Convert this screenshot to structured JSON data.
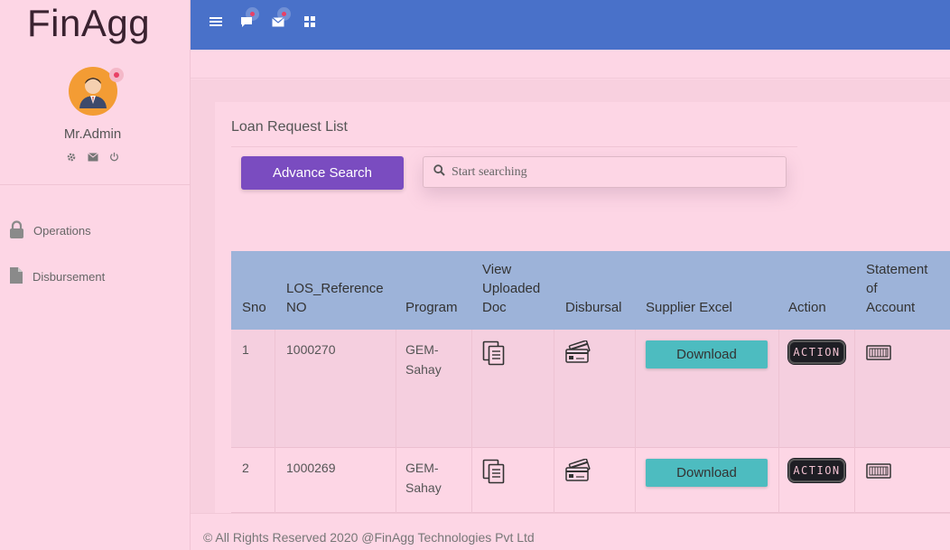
{
  "sidebar": {
    "brand": "FinAgg",
    "user_name": "Mr.Admin",
    "nav": [
      {
        "label": "Operations",
        "icon": "lock-icon"
      },
      {
        "label": "Disbursement",
        "icon": "file-icon"
      }
    ]
  },
  "topbar": {
    "icons": [
      "menu-icon",
      "chat-icon",
      "mail-icon",
      "grid-icon"
    ],
    "color": "#4971c9"
  },
  "card": {
    "title": "Loan Request List",
    "advance_search_label": "Advance Search",
    "search_placeholder": "Start searching"
  },
  "table": {
    "headers": {
      "sno": "Sno",
      "los_1": "LOS_Reference",
      "los_2": "NO",
      "program": "Program",
      "view_1": "View",
      "view_2": "Uploaded",
      "view_3": "Doc",
      "disbursal": "Disbursal",
      "supplier": "Supplier Excel",
      "action": "Action",
      "soa_1": "Statement",
      "soa_2": "of",
      "soa_3": "Account"
    },
    "rows": [
      {
        "sno": "1",
        "los": "1000270",
        "program_1": "GEM-",
        "program_2": "Sahay",
        "download": "Download",
        "action": "ACTION"
      },
      {
        "sno": "2",
        "los": "1000269",
        "program_1": "GEM-",
        "program_2": "Sahay",
        "download": "Download",
        "action": "ACTION"
      }
    ]
  },
  "footer": "© All Rights Reserved 2020 @FinAgg Technologies Pvt Ltd",
  "colors": {
    "accent": "#7a4cc0",
    "download": "#4dbcc0",
    "header": "#9db3d9",
    "background": "#fdd6e5"
  }
}
